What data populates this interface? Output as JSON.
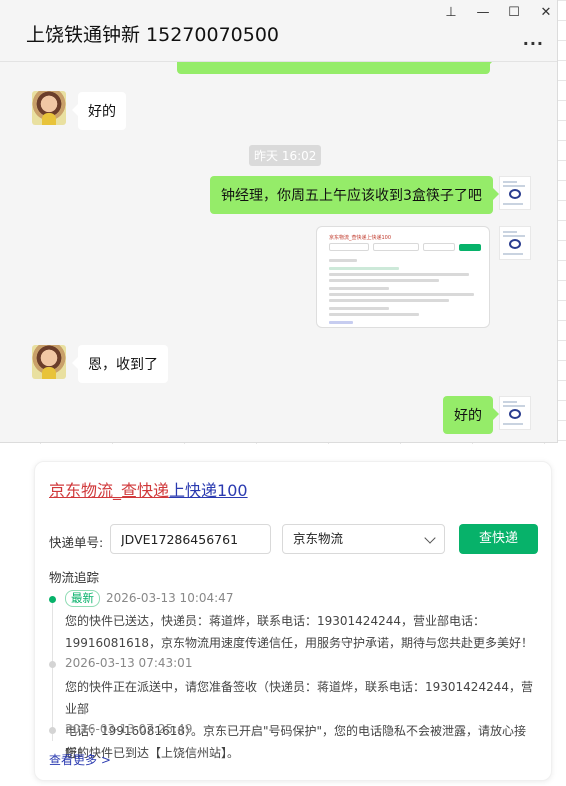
{
  "chat": {
    "title": "上饶铁通钟新 15270070500",
    "window_controls": {
      "pin": "⊥",
      "minimize": "—",
      "maximize": "☐",
      "close": "✕",
      "more": "..."
    },
    "messages": [
      {
        "side": "left",
        "text": "好的"
      },
      {
        "type": "time",
        "text": "昨天 16:02"
      },
      {
        "side": "right",
        "text": "钟经理，你周五上午应该收到3盒筷子了吧"
      },
      {
        "side": "right",
        "type": "card-thumbnail"
      },
      {
        "side": "left",
        "text": "恩，收到了"
      },
      {
        "side": "right",
        "text": "好的"
      }
    ],
    "thumbnail": {
      "title": "京东物流_查快递上快递100"
    }
  },
  "express": {
    "title_parts": [
      "京东物流",
      "_查快递",
      "上快递",
      "100"
    ],
    "tracking_label": "快递单号:",
    "tracking_value": "JDVE17286456761",
    "carrier_value": "京东物流",
    "query_button": "查快递",
    "track_title": "物流追踪",
    "events": [
      {
        "badge": "最新",
        "time": "2026-03-13 10:04:47",
        "line1": "您的快件已送达，快递员：蒋道烨，联系电话：19301424244，营业部电话：",
        "line2": "19916081618，京东物流用速度传递信任，用服务守护承诺，期待与您共赴更多美好！"
      },
      {
        "time": "2026-03-13 07:43:01",
        "line1": "您的快件正在派送中，请您准备签收（快递员：蒋道烨，联系电话：19301424244，营业部",
        "line2": "电话：19916081618）。京东已开启\"号码保护\"，您的电话隐私不会被泄露，请放心接听！"
      },
      {
        "time": "2026-03-13 07:25:49",
        "line1": "您的快件已到达【上饶信州站】。"
      }
    ],
    "see_more": "查看更多 >"
  },
  "colors": {
    "green_bubble": "#95ec69",
    "accent_green": "#07b26a",
    "title_red": "#d0393b",
    "title_blue": "#2a3ab0"
  }
}
